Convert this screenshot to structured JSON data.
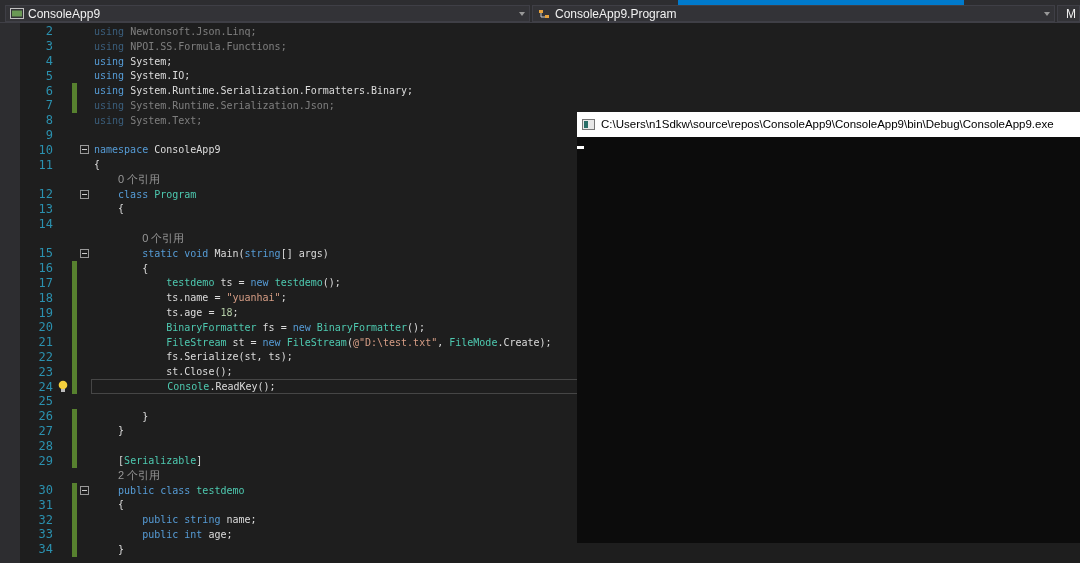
{
  "navigation_bar": {
    "project": "ConsoleApp9",
    "type": "ConsoleApp9.Program",
    "member": "M"
  },
  "editor": {
    "lines": [
      {
        "kind": "code",
        "num": "2",
        "faded": true,
        "changed": false,
        "fold": false,
        "current": false,
        "tokens": [
          {
            "t": "using",
            "kind": "kw"
          },
          {
            "t": " Newtonsoft.Json.Linq;",
            "kind": "plain"
          }
        ]
      },
      {
        "kind": "code",
        "num": "3",
        "faded": true,
        "changed": false,
        "fold": false,
        "current": false,
        "tokens": [
          {
            "t": "using",
            "kind": "kw"
          },
          {
            "t": " NPOI.SS.Formula.Functions;",
            "kind": "plain"
          }
        ]
      },
      {
        "kind": "code",
        "num": "4",
        "faded": false,
        "changed": false,
        "fold": false,
        "current": false,
        "tokens": [
          {
            "t": "using",
            "kind": "kw"
          },
          {
            "t": " System;",
            "kind": "plain"
          }
        ]
      },
      {
        "kind": "code",
        "num": "5",
        "faded": false,
        "changed": false,
        "fold": false,
        "current": false,
        "tokens": [
          {
            "t": "using",
            "kind": "kw"
          },
          {
            "t": " System.IO;",
            "kind": "plain"
          }
        ]
      },
      {
        "kind": "code",
        "num": "6",
        "faded": false,
        "changed": true,
        "fold": false,
        "current": false,
        "tokens": [
          {
            "t": "using",
            "kind": "kw"
          },
          {
            "t": " System.Runtime.Serialization.Formatters.Binary;",
            "kind": "plain"
          }
        ]
      },
      {
        "kind": "code",
        "num": "7",
        "faded": true,
        "changed": true,
        "fold": false,
        "current": false,
        "tokens": [
          {
            "t": "using",
            "kind": "kw"
          },
          {
            "t": " System.Runtime.Serialization.Json;",
            "kind": "plain"
          }
        ]
      },
      {
        "kind": "code",
        "num": "8",
        "faded": true,
        "changed": false,
        "fold": false,
        "current": false,
        "tokens": [
          {
            "t": "using",
            "kind": "kw"
          },
          {
            "t": " System.Text;",
            "kind": "plain"
          }
        ]
      },
      {
        "kind": "code",
        "num": "9",
        "changed": false,
        "fold": false,
        "current": false
      },
      {
        "kind": "code",
        "num": "10",
        "faded": false,
        "changed": false,
        "fold": true,
        "current": false,
        "tokens": [
          {
            "t": "namespace",
            "kind": "kw"
          },
          {
            "t": " ConsoleApp9",
            "kind": "plain"
          }
        ]
      },
      {
        "kind": "code",
        "num": "11",
        "faded": false,
        "changed": false,
        "fold": false,
        "current": false,
        "tokens": [
          {
            "t": "{",
            "kind": "plain"
          }
        ]
      },
      {
        "kind": "lens",
        "text": "0 个引用"
      },
      {
        "kind": "code",
        "num": "12",
        "faded": false,
        "changed": false,
        "fold": true,
        "current": false,
        "tokens": [
          {
            "t": "    class",
            "kind": "kw"
          },
          {
            "t": " Program",
            "kind": "type"
          }
        ]
      },
      {
        "kind": "code",
        "num": "13",
        "faded": false,
        "changed": false,
        "fold": false,
        "current": false,
        "tokens": [
          {
            "t": "    {",
            "kind": "plain"
          }
        ]
      },
      {
        "kind": "code",
        "num": "14",
        "changed": false,
        "fold": false,
        "current": false
      },
      {
        "kind": "lens",
        "text": "0 个引用"
      },
      {
        "kind": "code",
        "num": "15",
        "faded": false,
        "changed": false,
        "fold": true,
        "current": false,
        "tokens": [
          {
            "t": "        static void",
            "kind": "kw"
          },
          {
            "t": " Main(",
            "kind": "plain"
          },
          {
            "t": "string",
            "kind": "kw"
          },
          {
            "t": "[] args)",
            "kind": "plain"
          }
        ]
      },
      {
        "kind": "code",
        "num": "16",
        "faded": false,
        "changed": true,
        "fold": false,
        "current": false,
        "tokens": [
          {
            "t": "        {",
            "kind": "plain"
          }
        ]
      },
      {
        "kind": "code",
        "num": "17",
        "faded": false,
        "changed": true,
        "fold": false,
        "current": false,
        "tokens": [
          {
            "t": "            testdemo",
            "kind": "type"
          },
          {
            "t": " ts = ",
            "kind": "plain"
          },
          {
            "t": "new",
            "kind": "kw"
          },
          {
            "t": " testdemo",
            "kind": "type"
          },
          {
            "t": "();",
            "kind": "plain"
          }
        ]
      },
      {
        "kind": "code",
        "num": "18",
        "faded": false,
        "changed": true,
        "fold": false,
        "current": false,
        "tokens": [
          {
            "t": "            ts.name = ",
            "kind": "plain"
          },
          {
            "t": "\"yuanhai\"",
            "kind": "string"
          },
          {
            "t": ";",
            "kind": "plain"
          }
        ]
      },
      {
        "kind": "code",
        "num": "19",
        "faded": false,
        "changed": true,
        "fold": false,
        "current": false,
        "tokens": [
          {
            "t": "            ts.age = ",
            "kind": "plain"
          },
          {
            "t": "18",
            "kind": "number"
          },
          {
            "t": ";",
            "kind": "plain"
          }
        ]
      },
      {
        "kind": "code",
        "num": "20",
        "faded": false,
        "changed": true,
        "fold": false,
        "current": false,
        "tokens": [
          {
            "t": "            BinaryFormatter",
            "kind": "type"
          },
          {
            "t": " fs = ",
            "kind": "plain"
          },
          {
            "t": "new",
            "kind": "kw"
          },
          {
            "t": " BinaryFormatter",
            "kind": "type"
          },
          {
            "t": "();",
            "kind": "plain"
          }
        ]
      },
      {
        "kind": "code",
        "num": "21",
        "faded": false,
        "changed": true,
        "fold": false,
        "current": false,
        "tokens": [
          {
            "t": "            FileStream",
            "kind": "type"
          },
          {
            "t": " st = ",
            "kind": "plain"
          },
          {
            "t": "new",
            "kind": "kw"
          },
          {
            "t": " FileStream",
            "kind": "type"
          },
          {
            "t": "(",
            "kind": "plain"
          },
          {
            "t": "@\"D:\\test.txt\"",
            "kind": "string"
          },
          {
            "t": ", ",
            "kind": "plain"
          },
          {
            "t": "FileMode",
            "kind": "type"
          },
          {
            "t": ".Create);",
            "kind": "plain"
          }
        ]
      },
      {
        "kind": "code",
        "num": "22",
        "faded": false,
        "changed": true,
        "fold": false,
        "current": false,
        "tokens": [
          {
            "t": "            fs.Serialize(st, ts);",
            "kind": "plain"
          }
        ]
      },
      {
        "kind": "code",
        "num": "23",
        "faded": false,
        "changed": true,
        "fold": false,
        "current": false,
        "tokens": [
          {
            "t": "            st.Close();",
            "kind": "plain"
          }
        ]
      },
      {
        "kind": "code",
        "num": "24",
        "faded": false,
        "changed": true,
        "fold": false,
        "current": true,
        "tokens": [
          {
            "t": "            Console",
            "kind": "type"
          },
          {
            "t": ".ReadKey();",
            "kind": "plain"
          }
        ]
      },
      {
        "kind": "code",
        "num": "25",
        "changed": false,
        "fold": false,
        "current": false
      },
      {
        "kind": "code",
        "num": "26",
        "faded": false,
        "changed": true,
        "fold": false,
        "current": false,
        "tokens": [
          {
            "t": "        }",
            "kind": "plain"
          }
        ]
      },
      {
        "kind": "code",
        "num": "27",
        "faded": false,
        "changed": true,
        "fold": false,
        "current": false,
        "tokens": [
          {
            "t": "    }",
            "kind": "plain"
          }
        ]
      },
      {
        "kind": "code",
        "num": "28",
        "changed": true,
        "fold": false,
        "current": false
      },
      {
        "kind": "code",
        "num": "29",
        "faded": false,
        "changed": true,
        "fold": false,
        "current": false,
        "tokens": [
          {
            "t": "    [",
            "kind": "plain"
          },
          {
            "t": "Serializable",
            "kind": "type"
          },
          {
            "t": "]",
            "kind": "plain"
          }
        ]
      },
      {
        "kind": "lens",
        "text": "2 个引用"
      },
      {
        "kind": "code",
        "num": "30",
        "faded": false,
        "changed": true,
        "fold": true,
        "current": false,
        "tokens": [
          {
            "t": "    public class",
            "kind": "kw"
          },
          {
            "t": " testdemo",
            "kind": "type"
          }
        ]
      },
      {
        "kind": "code",
        "num": "31",
        "faded": false,
        "changed": true,
        "fold": false,
        "current": false,
        "tokens": [
          {
            "t": "    {",
            "kind": "plain"
          }
        ]
      },
      {
        "kind": "code",
        "num": "32",
        "faded": false,
        "changed": true,
        "fold": false,
        "current": false,
        "tokens": [
          {
            "t": "        public string",
            "kind": "kw"
          },
          {
            "t": " name;",
            "kind": "plain"
          }
        ]
      },
      {
        "kind": "code",
        "num": "33",
        "faded": false,
        "changed": true,
        "fold": false,
        "current": false,
        "tokens": [
          {
            "t": "        public int",
            "kind": "kw"
          },
          {
            "t": " age;",
            "kind": "plain"
          }
        ]
      },
      {
        "kind": "code",
        "num": "34",
        "faded": false,
        "changed": true,
        "fold": false,
        "current": false,
        "tokens": [
          {
            "t": "    }",
            "kind": "plain"
          }
        ]
      }
    ]
  },
  "console_window": {
    "title": "C:\\Users\\n1Sdkw\\source\\repos\\ConsoleApp9\\ConsoleApp9\\bin\\Debug\\ConsoleApp9.exe"
  }
}
